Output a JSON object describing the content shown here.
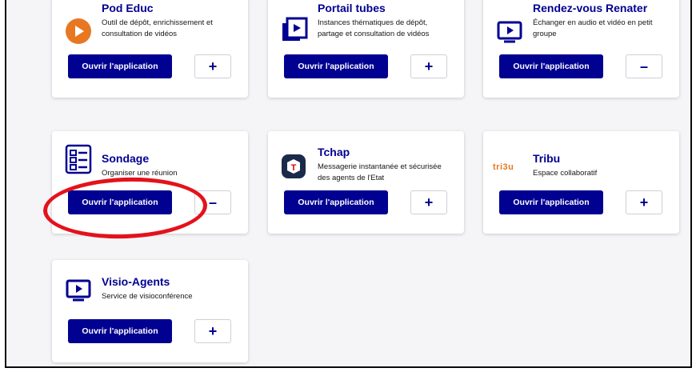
{
  "apps": [
    {
      "title": "Pod Educ",
      "description": "Outil de dépôt, enrichissement et consultation de vidéos",
      "open_label": "Ouvrir l'application",
      "toggle": "+",
      "icon": "pod-play-icon"
    },
    {
      "title": "Portail tubes",
      "description": "Instances thématiques de dépôt, partage et consultation de vidéos",
      "open_label": "Ouvrir l'application",
      "toggle": "+",
      "icon": "video-play-icon"
    },
    {
      "title": "Rendez-vous Renater",
      "description": "Échanger en audio et vidéo en petit groupe",
      "open_label": "Ouvrir l'application",
      "toggle": "–",
      "icon": "screen-play-icon"
    },
    {
      "title": "Sondage",
      "description": "Organiser une réunion",
      "open_label": "Ouvrir l'application",
      "toggle": "–",
      "icon": "checklist-icon"
    },
    {
      "title": "Tchap",
      "description": "Messagerie instantanée et sécurisée des agents de l'Etat",
      "open_label": "Ouvrir l'application",
      "toggle": "+",
      "icon": "tchap-logo-icon"
    },
    {
      "title": "Tribu",
      "description": "Espace collaboratif",
      "open_label": "Ouvrir l'application",
      "toggle": "+",
      "icon": "tribu-logo-icon",
      "logo_text": "tri3u"
    },
    {
      "title": "Visio-Agents",
      "description": "Service de visioconférence",
      "open_label": "Ouvrir l'application",
      "toggle": "+",
      "icon": "screen-play-icon"
    }
  ],
  "annotation": {
    "color": "#e4121b",
    "target": "Sondage open button"
  },
  "colors": {
    "brand_blue": "#000091",
    "tchap_red": "#e1000f",
    "pod_orange": "#e87722"
  }
}
